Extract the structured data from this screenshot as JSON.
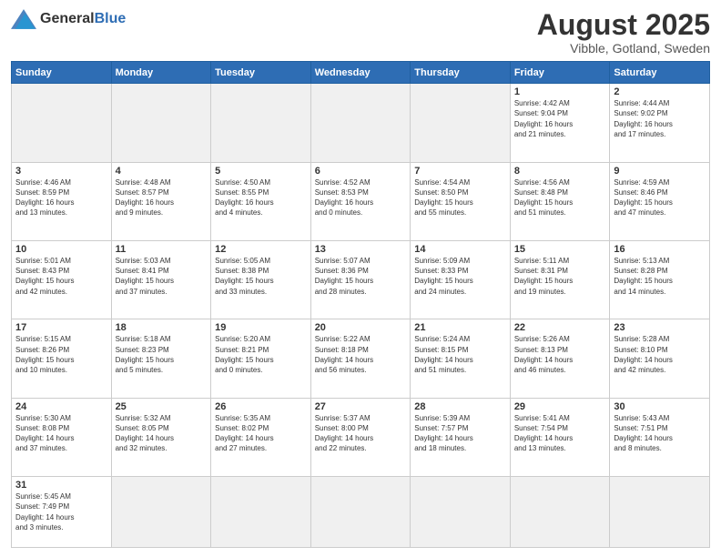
{
  "header": {
    "logo_general": "General",
    "logo_blue": "Blue",
    "month_title": "August 2025",
    "subtitle": "Vibble, Gotland, Sweden"
  },
  "weekdays": [
    "Sunday",
    "Monday",
    "Tuesday",
    "Wednesday",
    "Thursday",
    "Friday",
    "Saturday"
  ],
  "weeks": [
    [
      {
        "day": "",
        "info": ""
      },
      {
        "day": "",
        "info": ""
      },
      {
        "day": "",
        "info": ""
      },
      {
        "day": "",
        "info": ""
      },
      {
        "day": "",
        "info": ""
      },
      {
        "day": "1",
        "info": "Sunrise: 4:42 AM\nSunset: 9:04 PM\nDaylight: 16 hours\nand 21 minutes."
      },
      {
        "day": "2",
        "info": "Sunrise: 4:44 AM\nSunset: 9:02 PM\nDaylight: 16 hours\nand 17 minutes."
      }
    ],
    [
      {
        "day": "3",
        "info": "Sunrise: 4:46 AM\nSunset: 8:59 PM\nDaylight: 16 hours\nand 13 minutes."
      },
      {
        "day": "4",
        "info": "Sunrise: 4:48 AM\nSunset: 8:57 PM\nDaylight: 16 hours\nand 9 minutes."
      },
      {
        "day": "5",
        "info": "Sunrise: 4:50 AM\nSunset: 8:55 PM\nDaylight: 16 hours\nand 4 minutes."
      },
      {
        "day": "6",
        "info": "Sunrise: 4:52 AM\nSunset: 8:53 PM\nDaylight: 16 hours\nand 0 minutes."
      },
      {
        "day": "7",
        "info": "Sunrise: 4:54 AM\nSunset: 8:50 PM\nDaylight: 15 hours\nand 55 minutes."
      },
      {
        "day": "8",
        "info": "Sunrise: 4:56 AM\nSunset: 8:48 PM\nDaylight: 15 hours\nand 51 minutes."
      },
      {
        "day": "9",
        "info": "Sunrise: 4:59 AM\nSunset: 8:46 PM\nDaylight: 15 hours\nand 47 minutes."
      }
    ],
    [
      {
        "day": "10",
        "info": "Sunrise: 5:01 AM\nSunset: 8:43 PM\nDaylight: 15 hours\nand 42 minutes."
      },
      {
        "day": "11",
        "info": "Sunrise: 5:03 AM\nSunset: 8:41 PM\nDaylight: 15 hours\nand 37 minutes."
      },
      {
        "day": "12",
        "info": "Sunrise: 5:05 AM\nSunset: 8:38 PM\nDaylight: 15 hours\nand 33 minutes."
      },
      {
        "day": "13",
        "info": "Sunrise: 5:07 AM\nSunset: 8:36 PM\nDaylight: 15 hours\nand 28 minutes."
      },
      {
        "day": "14",
        "info": "Sunrise: 5:09 AM\nSunset: 8:33 PM\nDaylight: 15 hours\nand 24 minutes."
      },
      {
        "day": "15",
        "info": "Sunrise: 5:11 AM\nSunset: 8:31 PM\nDaylight: 15 hours\nand 19 minutes."
      },
      {
        "day": "16",
        "info": "Sunrise: 5:13 AM\nSunset: 8:28 PM\nDaylight: 15 hours\nand 14 minutes."
      }
    ],
    [
      {
        "day": "17",
        "info": "Sunrise: 5:15 AM\nSunset: 8:26 PM\nDaylight: 15 hours\nand 10 minutes."
      },
      {
        "day": "18",
        "info": "Sunrise: 5:18 AM\nSunset: 8:23 PM\nDaylight: 15 hours\nand 5 minutes."
      },
      {
        "day": "19",
        "info": "Sunrise: 5:20 AM\nSunset: 8:21 PM\nDaylight: 15 hours\nand 0 minutes."
      },
      {
        "day": "20",
        "info": "Sunrise: 5:22 AM\nSunset: 8:18 PM\nDaylight: 14 hours\nand 56 minutes."
      },
      {
        "day": "21",
        "info": "Sunrise: 5:24 AM\nSunset: 8:15 PM\nDaylight: 14 hours\nand 51 minutes."
      },
      {
        "day": "22",
        "info": "Sunrise: 5:26 AM\nSunset: 8:13 PM\nDaylight: 14 hours\nand 46 minutes."
      },
      {
        "day": "23",
        "info": "Sunrise: 5:28 AM\nSunset: 8:10 PM\nDaylight: 14 hours\nand 42 minutes."
      }
    ],
    [
      {
        "day": "24",
        "info": "Sunrise: 5:30 AM\nSunset: 8:08 PM\nDaylight: 14 hours\nand 37 minutes."
      },
      {
        "day": "25",
        "info": "Sunrise: 5:32 AM\nSunset: 8:05 PM\nDaylight: 14 hours\nand 32 minutes."
      },
      {
        "day": "26",
        "info": "Sunrise: 5:35 AM\nSunset: 8:02 PM\nDaylight: 14 hours\nand 27 minutes."
      },
      {
        "day": "27",
        "info": "Sunrise: 5:37 AM\nSunset: 8:00 PM\nDaylight: 14 hours\nand 22 minutes."
      },
      {
        "day": "28",
        "info": "Sunrise: 5:39 AM\nSunset: 7:57 PM\nDaylight: 14 hours\nand 18 minutes."
      },
      {
        "day": "29",
        "info": "Sunrise: 5:41 AM\nSunset: 7:54 PM\nDaylight: 14 hours\nand 13 minutes."
      },
      {
        "day": "30",
        "info": "Sunrise: 5:43 AM\nSunset: 7:51 PM\nDaylight: 14 hours\nand 8 minutes."
      }
    ],
    [
      {
        "day": "31",
        "info": "Sunrise: 5:45 AM\nSunset: 7:49 PM\nDaylight: 14 hours\nand 3 minutes."
      },
      {
        "day": "",
        "info": ""
      },
      {
        "day": "",
        "info": ""
      },
      {
        "day": "",
        "info": ""
      },
      {
        "day": "",
        "info": ""
      },
      {
        "day": "",
        "info": ""
      },
      {
        "day": "",
        "info": ""
      }
    ]
  ]
}
